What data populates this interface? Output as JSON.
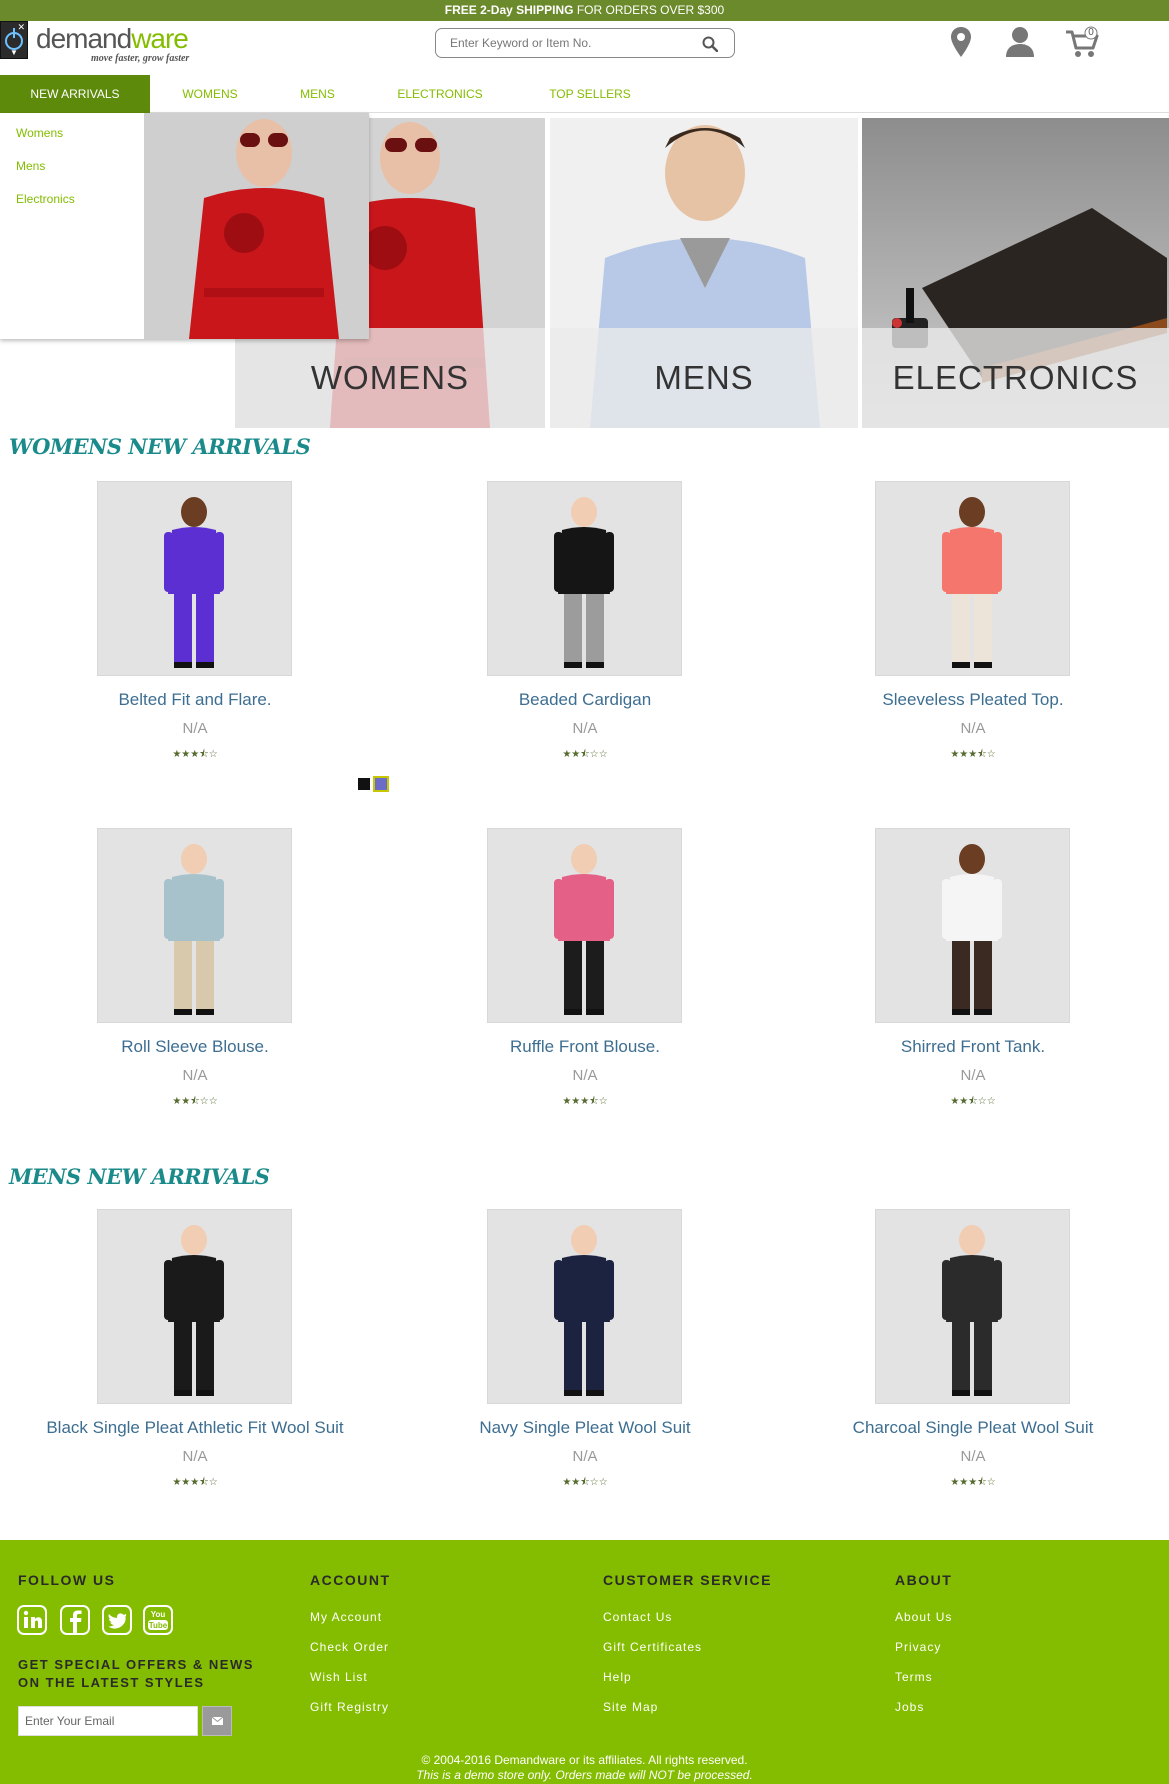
{
  "banner": {
    "bold": "FREE 2-Day SHIPPING",
    "text": " FOR ORDERS OVER $300"
  },
  "header": {
    "logo_part1": "demand",
    "logo_part2": "ware",
    "logo_tagline": "move faster, grow faster",
    "search_placeholder": "Enter Keyword or Item No.",
    "cart_count": "0",
    "icons": [
      "power-icon",
      "location-pin-icon",
      "user-icon",
      "cart-icon",
      "search-icon"
    ]
  },
  "nav": {
    "items": [
      "NEW ARRIVALS",
      "WOMENS",
      "MENS",
      "ELECTRONICS",
      "TOP SELLERS"
    ]
  },
  "dropdown": {
    "items": [
      "Womens",
      "Mens",
      "Electronics"
    ]
  },
  "hero": {
    "tiles": [
      "WOMENS",
      "MENS",
      "ELECTRONICS"
    ]
  },
  "womens": {
    "title": "WOMENS NEW ARRIVALS",
    "products": [
      {
        "name": "Belted Fit and Flare.",
        "price": "N/A",
        "rating": 3.5
      },
      {
        "name": "Beaded Cardigan",
        "price": "N/A",
        "rating": 2.5
      },
      {
        "name": "Sleeveless Pleated Top.",
        "price": "N/A",
        "rating": 3.5
      },
      {
        "name": "Roll Sleeve Blouse.",
        "price": "N/A",
        "rating": 2.5
      },
      {
        "name": "Ruffle Front Blouse.",
        "price": "N/A",
        "rating": 3.5
      },
      {
        "name": "Shirred Front Tank.",
        "price": "N/A",
        "rating": 2.5
      }
    ],
    "swatches": [
      "#111111",
      "#6b6bc8"
    ]
  },
  "mens": {
    "title": "MENS NEW ARRIVALS",
    "products": [
      {
        "name": "Black Single Pleat Athletic Fit Wool Suit",
        "price": "N/A",
        "rating": 3.5
      },
      {
        "name": "Navy Single Pleat Wool Suit",
        "price": "N/A",
        "rating": 2.5
      },
      {
        "name": "Charcoal Single Pleat Wool Suit",
        "price": "N/A",
        "rating": 3.5
      }
    ]
  },
  "footer": {
    "follow_heading": "FOLLOW US",
    "social": [
      "linkedin-icon",
      "facebook-icon",
      "twitter-icon",
      "youtube-icon"
    ],
    "offers_line1": "GET SPECIAL OFFERS & NEWS",
    "offers_line2": "ON THE LATEST STYLES",
    "email_placeholder": "Enter Your Email",
    "account_heading": "ACCOUNT",
    "account_links": [
      "My Account",
      "Check Order",
      "Wish List",
      "Gift Registry"
    ],
    "service_heading": "CUSTOMER SERVICE",
    "service_links": [
      "Contact Us",
      "Gift Certificates",
      "Help",
      "Site Map"
    ],
    "about_heading": "ABOUT",
    "about_links": [
      "About Us",
      "Privacy",
      "Terms",
      "Jobs"
    ],
    "copyright": "© 2004-2016 Demandware or its affiliates. All rights reserved.",
    "disclaimer": "This is a demo store only. Orders made will NOT be processed."
  },
  "colors": {
    "banner": "#6b8a2b",
    "accent_green": "#84bd00",
    "nav_active": "#5e8a0c",
    "section_title": "#1a8a8a",
    "product_link": "#3d6e91"
  }
}
